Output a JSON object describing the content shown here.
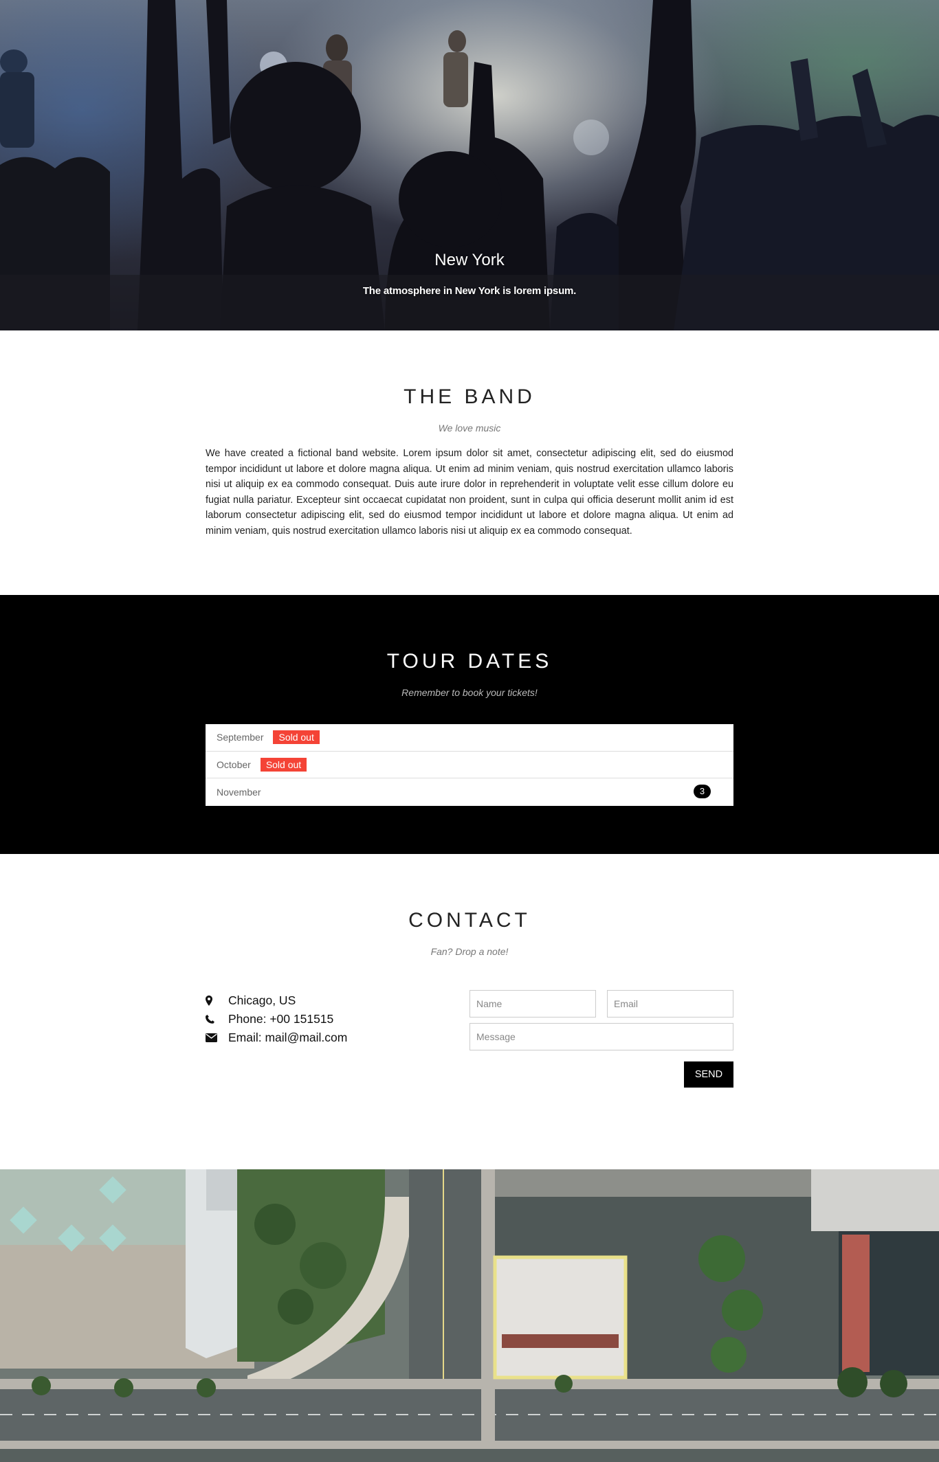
{
  "hero": {
    "title": "New York",
    "subtitle": "The atmosphere in New York is lorem ipsum."
  },
  "band": {
    "title": "THE BAND",
    "subtitle": "We love music",
    "text": "We have created a fictional band website. Lorem ipsum dolor sit amet, consectetur adipiscing elit, sed do eiusmod tempor incididunt ut labore et dolore magna aliqua. Ut enim ad minim veniam, quis nostrud exercitation ullamco laboris nisi ut aliquip ex ea commodo consequat. Duis aute irure dolor in reprehenderit in voluptate velit esse cillum dolore eu fugiat nulla pariatur. Excepteur sint occaecat cupidatat non proident, sunt in culpa qui officia deserunt mollit anim id est laborum consectetur adipiscing elit, sed do eiusmod tempor incididunt ut labore et dolore magna aliqua. Ut enim ad minim veniam, quis nostrud exercitation ullamco laboris nisi ut aliquip ex ea commodo consequat."
  },
  "tour": {
    "title": "TOUR DATES",
    "subtitle": "Remember to book your tickets!",
    "months": [
      {
        "label": "September",
        "badge": "Sold out"
      },
      {
        "label": "October",
        "badge": "Sold out"
      },
      {
        "label": "November",
        "count": "3"
      }
    ]
  },
  "contact": {
    "title": "CONTACT",
    "subtitle": "Fan? Drop a note!",
    "location": "Chicago, US",
    "phone": "Phone: +00 151515",
    "email": "Email: mail@mail.com",
    "form": {
      "name_placeholder": "Name",
      "email_placeholder": "Email",
      "message_placeholder": "Message",
      "send_label": "SEND"
    }
  },
  "colors": {
    "sold_out": "#f44336",
    "tour_bg": "#000000",
    "send_button": "#000000"
  },
  "icons": {
    "location": "map-marker-icon",
    "phone": "phone-icon",
    "email": "envelope-icon"
  }
}
